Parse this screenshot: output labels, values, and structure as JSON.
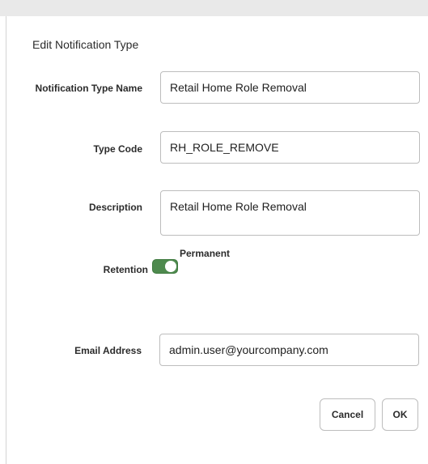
{
  "dialog": {
    "title": "Edit Notification Type"
  },
  "form": {
    "name_label": "Notification Type Name",
    "name_value": "Retail Home Role Removal",
    "code_label": "Type Code",
    "code_value": "RH_ROLE_REMOVE",
    "description_label": "Description",
    "description_value": "Retail Home Role Removal",
    "retention_label": "Retention",
    "retention_toggle_label": "Permanent",
    "retention_on": true,
    "email_label": "Email Address",
    "email_value": "admin.user@yourcompany.com"
  },
  "buttons": {
    "cancel_label": "Cancel",
    "ok_label": "OK"
  },
  "colors": {
    "toggle_on": "#4e8a4e",
    "border": "#bdbdbd"
  }
}
